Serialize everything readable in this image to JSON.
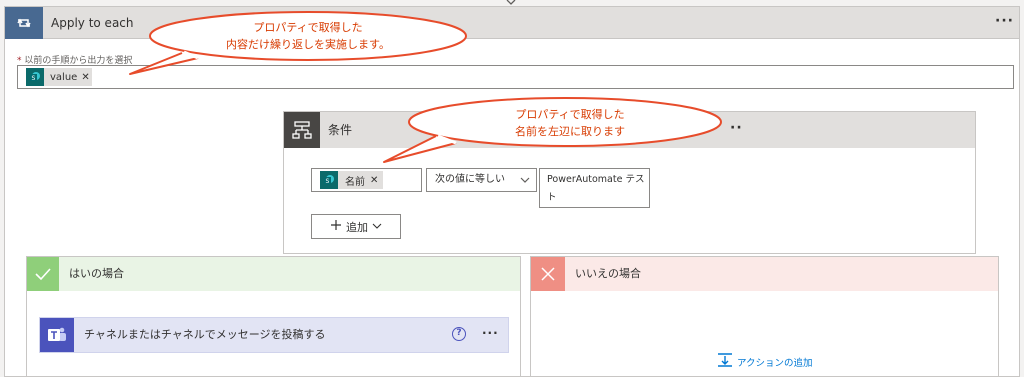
{
  "loop": {
    "title": "Apply to each",
    "more": "···"
  },
  "select_output": {
    "label": "以前の手順から出力を選択",
    "required_mark": "*",
    "token": "value",
    "remove": "✕"
  },
  "condition": {
    "title": "条件",
    "more": "··",
    "left_token": "名前",
    "remove": "✕",
    "operator": "次の値に等しい",
    "right_value_line1": "PowerAutomate テス",
    "right_value_line2": "ト",
    "add_label": "追加"
  },
  "yes_branch": {
    "title": "はいの場合",
    "action": {
      "title": "チャネルまたはチャネルでメッセージを投稿する",
      "help": "?",
      "more": "···"
    }
  },
  "no_branch": {
    "title": "いいえの場合",
    "add_action": "アクションの追加"
  },
  "callouts": {
    "c1_line1": "プロパティで取得した",
    "c1_line2": "内容だけ繰り返しを実施します。",
    "c2_line1": "プロパティで取得した",
    "c2_line2": "名前を左辺に取ります"
  },
  "icons": [
    "loop-icon",
    "sharepoint-icon",
    "condition-icon",
    "plus-icon",
    "chevron-down-icon",
    "checkmark-icon",
    "close-icon",
    "teams-icon",
    "help-icon",
    "add-action-icon"
  ],
  "colors": {
    "loop_header": "#486991",
    "condition_header": "#484644",
    "yes": "#8fcf7a",
    "no": "#ef8f84",
    "teams": "#4b53bc",
    "callout": "#d83b01"
  }
}
